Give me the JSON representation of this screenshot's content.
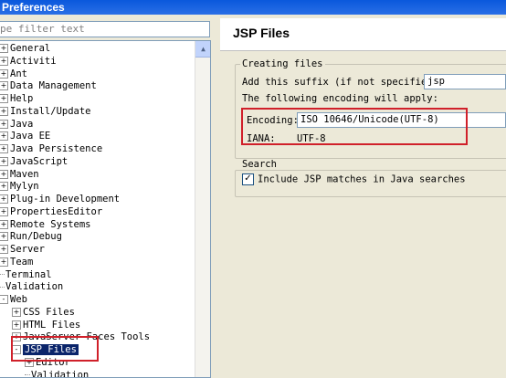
{
  "window": {
    "title": "Preferences"
  },
  "filter": {
    "placeholder": "type filter text",
    "visible_text": "pe filter text"
  },
  "tree": {
    "items": [
      {
        "label": "General",
        "expander": "+"
      },
      {
        "label": "Activiti",
        "expander": "+"
      },
      {
        "label": "Ant",
        "expander": "+"
      },
      {
        "label": "Data Management",
        "expander": "+"
      },
      {
        "label": "Help",
        "expander": "+"
      },
      {
        "label": "Install/Update",
        "expander": "+"
      },
      {
        "label": "Java",
        "expander": "+"
      },
      {
        "label": "Java EE",
        "expander": "+"
      },
      {
        "label": "Java Persistence",
        "expander": "+"
      },
      {
        "label": "JavaScript",
        "expander": "+"
      },
      {
        "label": "Maven",
        "expander": "+"
      },
      {
        "label": "Mylyn",
        "expander": "+"
      },
      {
        "label": "Plug-in Development",
        "expander": "+"
      },
      {
        "label": "PropertiesEditor",
        "expander": "+"
      },
      {
        "label": "Remote Systems",
        "expander": "+"
      },
      {
        "label": "Run/Debug",
        "expander": "+"
      },
      {
        "label": "Server",
        "expander": "+"
      },
      {
        "label": "Team",
        "expander": "+"
      },
      {
        "label": "Terminal",
        "expander": ""
      },
      {
        "label": "Validation",
        "expander": ""
      },
      {
        "label": "Web",
        "expander": "-"
      },
      {
        "label": "CSS Files",
        "expander": "+"
      },
      {
        "label": "HTML Files",
        "expander": "+"
      },
      {
        "label": "JavaServer Faces Tools",
        "expander": "+"
      },
      {
        "label": "JSP Files",
        "expander": "-",
        "selected": true
      },
      {
        "label": "Editor",
        "expander": "+"
      },
      {
        "label": "Validation",
        "expander": ""
      }
    ]
  },
  "page": {
    "title": "JSP Files",
    "creating": {
      "group_label": "Creating files",
      "suffix_label": "Add this suffix (if not specified):",
      "suffix_value": "jsp",
      "encoding_note": "The following encoding will apply:",
      "encoding_label": "Encoding:",
      "encoding_value": "ISO 10646/Unicode(UTF-8)",
      "iana_label": "IANA:",
      "iana_value": "UTF-8"
    },
    "search": {
      "group_label": "Search",
      "checkbox_label": "Include JSP matches in Java searches",
      "checked": true
    }
  },
  "colors": {
    "highlight": "#d0202a",
    "selection": "#0a246a",
    "titlebar": "#0a58dc"
  }
}
